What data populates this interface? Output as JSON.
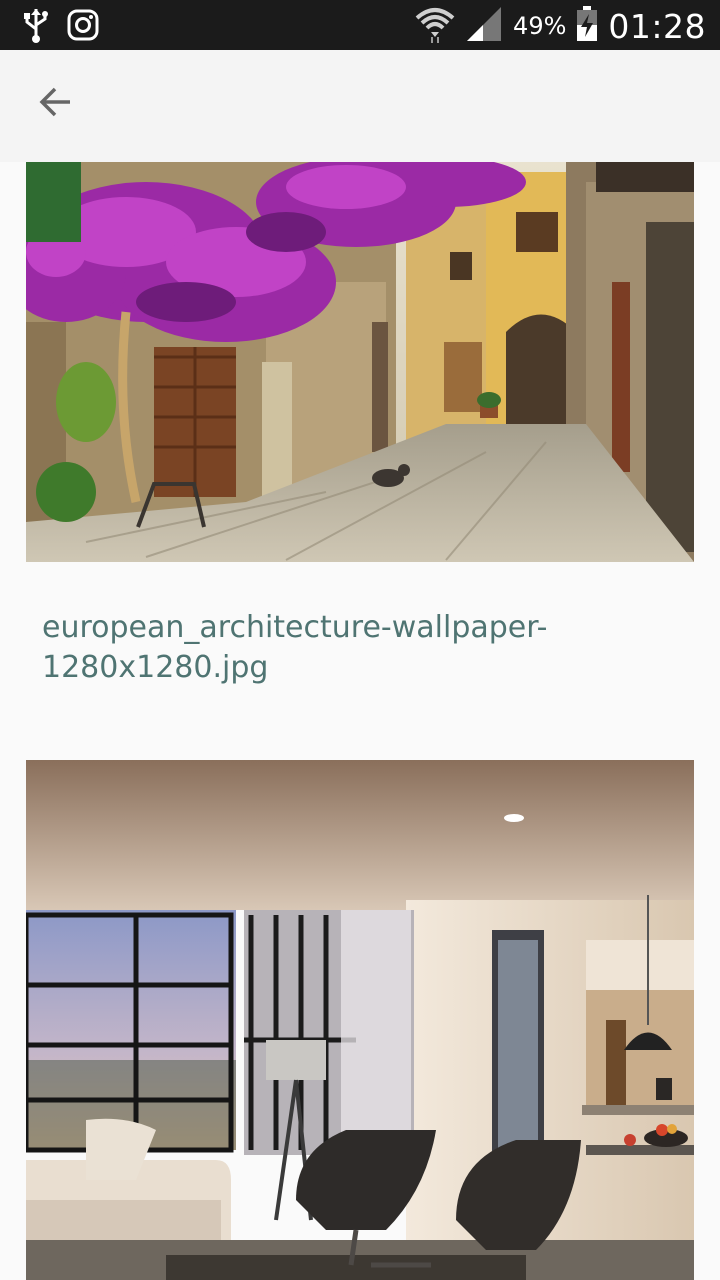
{
  "status_bar": {
    "battery_percent": "49%",
    "time": "01:28",
    "icons": [
      "usb-icon",
      "instagram-icon",
      "wifi-icon",
      "signal-icon",
      "battery-charging-icon"
    ]
  },
  "app_bar": {
    "back_icon": "arrow-back-icon"
  },
  "items": [
    {
      "image_description": "street scene with bougainvillea",
      "filename": "european_architecture-wallpaper-1280x1280.jpg"
    },
    {
      "image_description": "modern living room interior"
    }
  ],
  "colors": {
    "status_bar_bg": "#1b1b1b",
    "app_bar_bg": "#f4f4f4",
    "page_bg": "#fafafa",
    "filename_text": "#4f7472"
  }
}
